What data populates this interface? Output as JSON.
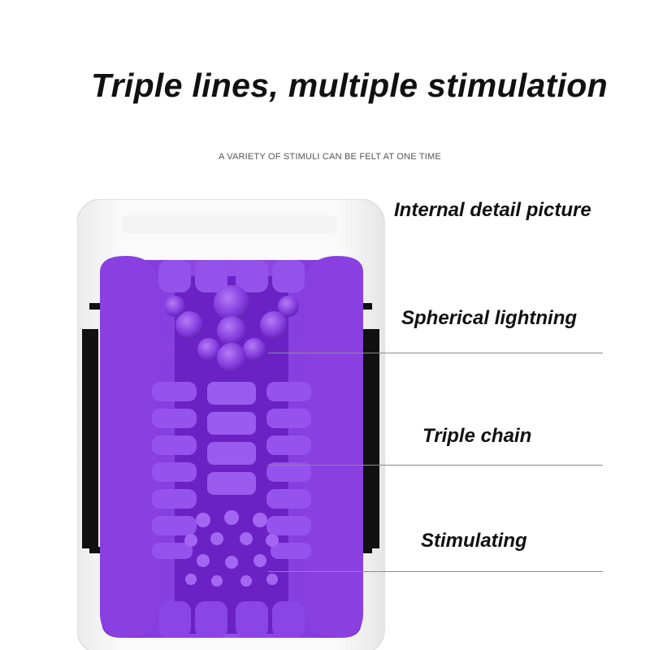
{
  "header": {
    "title": "Triple lines, multiple stimulation",
    "subtitle": "A VARIETY OF STIMULI CAN BE FELT AT ONE TIME"
  },
  "labels": {
    "internal": "Internal detail picture",
    "spherical": "Spherical lightning",
    "chain": "Triple chain",
    "stimulating": "Stimulating"
  },
  "colors": {
    "accent_purple": "#8a3fe0",
    "background": "#ffffff",
    "text": "#111111"
  }
}
